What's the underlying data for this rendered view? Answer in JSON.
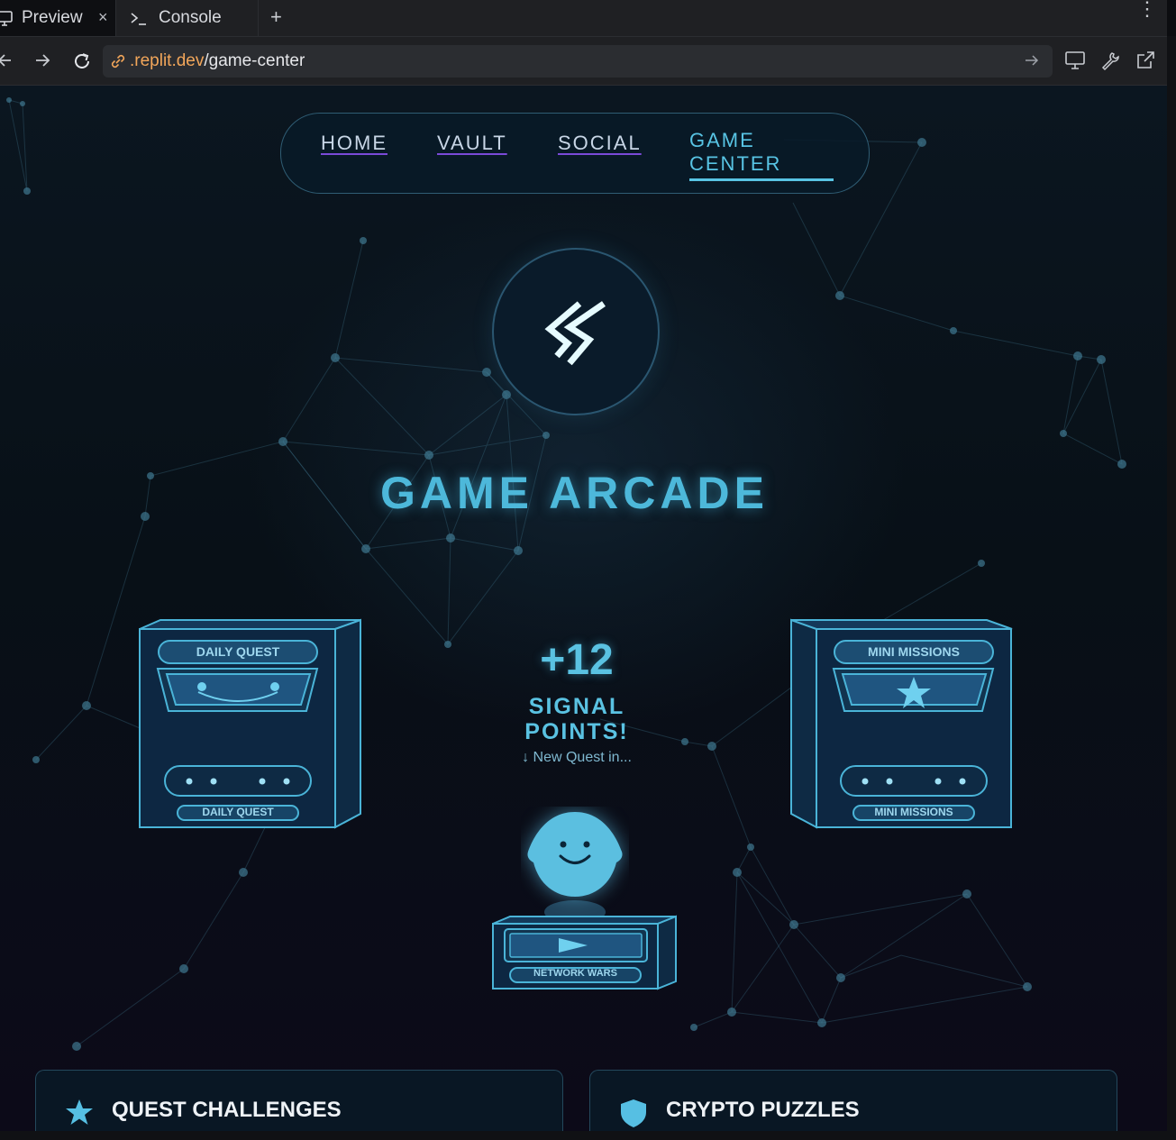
{
  "browser": {
    "tabs": [
      {
        "label": "Preview",
        "active": true
      },
      {
        "label": "Console",
        "active": false
      }
    ],
    "close_symbol": "×",
    "new_tab_symbol": "+",
    "menu_symbol": "⋮",
    "url_domain": ".replit.dev",
    "url_path": "/game-center"
  },
  "nav": {
    "items": [
      "HOME",
      "VAULT",
      "SOCIAL"
    ],
    "active_line1": "GAME",
    "active_line2": "CENTER"
  },
  "hero": {
    "title": "GAME ARCADE"
  },
  "cabinets": {
    "left_top_label": "DAILY QUEST",
    "left_bottom_label": "DAILY QUEST",
    "right_top_label": "MINI MISSIONS",
    "right_bottom_label": "MINI MISSIONS",
    "center_label": "NETWORK WARS"
  },
  "points": {
    "value": "+12",
    "label_line1": "SIGNAL",
    "label_line2": "POINTS!",
    "subtext": "↓ New Quest in..."
  },
  "cards": [
    {
      "title": "QUEST CHALLENGES",
      "icon": "star-icon"
    },
    {
      "title": "CRYPTO PUZZLES",
      "icon": "shield-icon"
    }
  ],
  "colors": {
    "accent": "#4db8da",
    "nav_underline": "#7a4ad8",
    "url_domain": "#f2a65a",
    "background": "#081017"
  }
}
